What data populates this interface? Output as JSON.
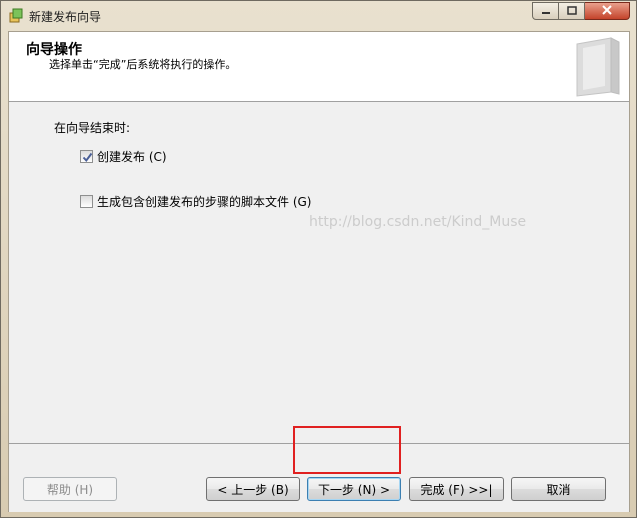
{
  "window": {
    "title": "新建发布向导",
    "icons": {
      "app": "wizard-app-icon",
      "minimize": "minimize-icon",
      "maximize": "maximize-icon",
      "close": "close-icon"
    }
  },
  "header": {
    "title": "向导操作",
    "subtitle": "选择单击“完成”后系统将执行的操作。",
    "art_icon": "wizard-banner-icon"
  },
  "body": {
    "label": "在向导结束时:",
    "options": [
      {
        "label": "创建发布 (C)",
        "checked": true
      },
      {
        "label": "生成包含创建发布的步骤的脚本文件 (G)",
        "checked": false
      }
    ]
  },
  "buttons": {
    "help": "帮助 (H)",
    "prev": "< 上一步 (B)",
    "next": "下一步 (N) >",
    "finish": "完成 (F) >>|",
    "cancel": "取消"
  },
  "overlay": {
    "watermark": "http://blog.csdn.net/Kind_Muse",
    "highlight_color": "#e02020"
  }
}
